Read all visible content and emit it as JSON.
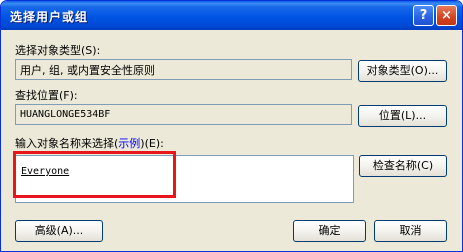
{
  "window": {
    "title": "选择用户或组",
    "help_icon": "?",
    "close_icon": "×"
  },
  "object_types": {
    "label": "选择对象类型(S):",
    "value": "用户, 组, 或内置安全性原则",
    "button": "对象类型(O)..."
  },
  "location": {
    "label": "查找位置(F):",
    "value": "HUANGLONGE534BF",
    "button": "位置(L)..."
  },
  "names": {
    "label_prefix": "输入对象名称来选择(",
    "label_link": "示例",
    "label_suffix": ")(E):",
    "entry": "Everyone",
    "check_button": "检查名称(C)"
  },
  "footer": {
    "advanced_button": "高级(A)...",
    "ok_button": "确定",
    "cancel_button": "取消"
  },
  "colors": {
    "title_bar": "#0054E3",
    "dialog_bg": "#ECE9D8",
    "highlight": "#E8161A",
    "link": "#0000FF"
  }
}
